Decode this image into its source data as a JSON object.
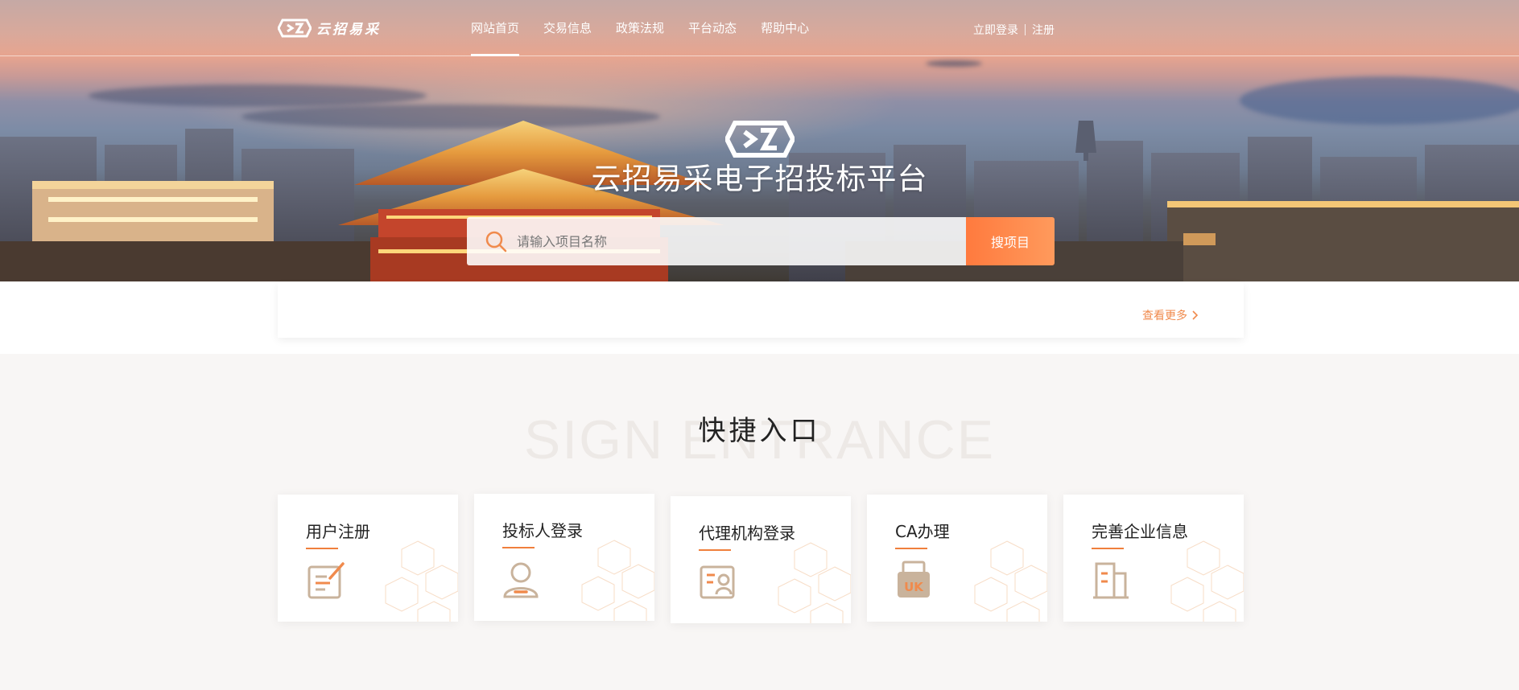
{
  "brand": {
    "logo_text": "云招易采",
    "accent": "#f07f3c",
    "button_gradient": [
      "#ff7a3e",
      "#ff9a5c"
    ]
  },
  "nav": {
    "items": [
      {
        "label": "网站首页",
        "active": true
      },
      {
        "label": "交易信息",
        "active": false
      },
      {
        "label": "政策法规",
        "active": false
      },
      {
        "label": "平台动态",
        "active": false
      },
      {
        "label": "帮助中心",
        "active": false
      }
    ],
    "login_label": "立即登录",
    "register_label": "注册"
  },
  "hero": {
    "title": "云招易采电子招投标平台",
    "search_placeholder": "请输入项目名称",
    "search_button": "搜项目"
  },
  "notice": {
    "more_label": "查看更多"
  },
  "quick_entry": {
    "title": "快捷入口",
    "bg_text": "SIGN ENTRANCE",
    "cards": [
      {
        "label": "用户注册",
        "icon": "edit-form-icon"
      },
      {
        "label": "投标人登录",
        "icon": "user-icon"
      },
      {
        "label": "代理机构登录",
        "icon": "id-card-icon"
      },
      {
        "label": "CA办理",
        "icon": "uk-key-icon",
        "icon_text": "UK"
      },
      {
        "label": "完善企业信息",
        "icon": "building-icon"
      }
    ]
  }
}
